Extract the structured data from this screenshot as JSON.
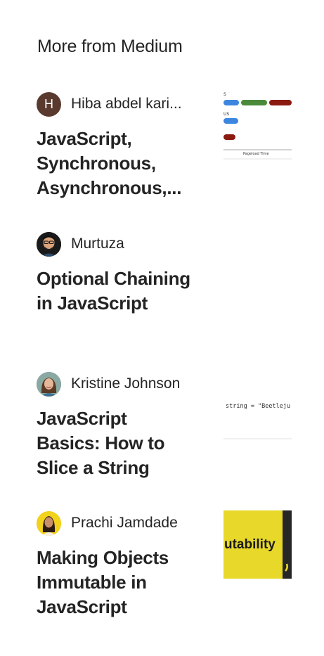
{
  "section": {
    "title": "More from Medium"
  },
  "articles": [
    {
      "author": "Hiba abdel kari...",
      "avatar_initial": "H",
      "avatar_color": "#5a3a2e",
      "title": "JavaScript, Synchronous, Asynchronous,...",
      "thumb_caption": "Pageload Time"
    },
    {
      "author": "Murtuza",
      "avatar_color": "#1a1a1a",
      "title": "Optional Chaining in JavaScript"
    },
    {
      "author": "Kristine Johnson",
      "avatar_color": "#6f8e8a",
      "title": "JavaScript Basics: How to Slice a String",
      "thumb_code": "string = \"Beetleju"
    },
    {
      "author": "Prachi Jamdade",
      "avatar_color": "#f1c40f",
      "title": "Making Objects Immutable in JavaScript",
      "thumb_text": "utability",
      "thumb_color": "#e8d82a"
    }
  ]
}
